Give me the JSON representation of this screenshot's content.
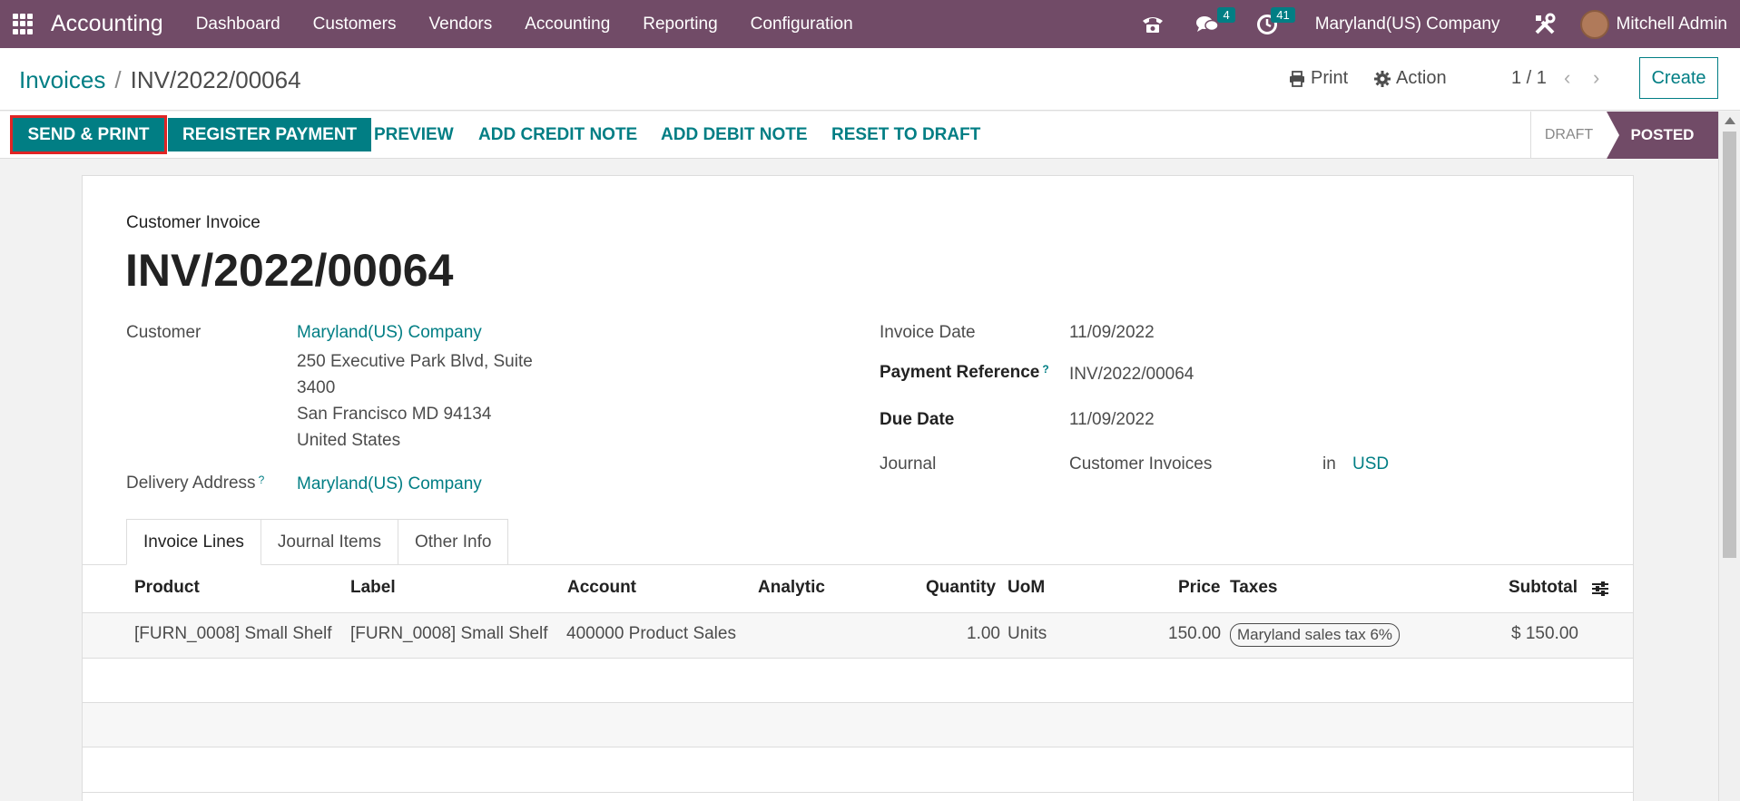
{
  "navbar": {
    "app_name": "Accounting",
    "menu": [
      "Dashboard",
      "Customers",
      "Vendors",
      "Accounting",
      "Reporting",
      "Configuration"
    ],
    "messages_count": "4",
    "activities_count": "41",
    "company": "Maryland(US) Company",
    "user": "Mitchell Admin"
  },
  "control_panel": {
    "breadcrumb_parent": "Invoices",
    "breadcrumb_separator": "/",
    "breadcrumb_current": "INV/2022/00064",
    "print_label": "Print",
    "action_label": "Action",
    "pager": "1 / 1",
    "create_label": "Create"
  },
  "statusbar": {
    "buttons": [
      "SEND & PRINT",
      "REGISTER PAYMENT",
      "PREVIEW",
      "ADD CREDIT NOTE",
      "ADD DEBIT NOTE",
      "RESET TO DRAFT"
    ],
    "stages": [
      "DRAFT",
      "POSTED"
    ],
    "current_stage": "POSTED"
  },
  "invoice": {
    "type_label": "Customer Invoice",
    "number": "INV/2022/00064",
    "customer_label": "Customer",
    "customer_name": "Maryland(US) Company",
    "customer_address": [
      "250 Executive Park Blvd, Suite",
      "3400",
      "San Francisco MD 94134",
      "United States"
    ],
    "delivery_label": "Delivery Address",
    "delivery_value": "Maryland(US) Company",
    "help_mark": "?",
    "invoice_date_label": "Invoice Date",
    "invoice_date": "11/09/2022",
    "payment_ref_label": "Payment Reference",
    "payment_ref": "INV/2022/00064",
    "due_date_label": "Due Date",
    "due_date": "11/09/2022",
    "journal_label": "Journal",
    "journal": "Customer Invoices",
    "journal_in": "in",
    "currency": "USD"
  },
  "tabs": [
    "Invoice Lines",
    "Journal Items",
    "Other Info"
  ],
  "lines": {
    "headers": [
      "Product",
      "Label",
      "Account",
      "Analytic",
      "Quantity",
      "UoM",
      "Price",
      "Taxes",
      "Subtotal"
    ],
    "rows": [
      {
        "product": "[FURN_0008] Small Shelf",
        "label": "[FURN_0008] Small Shelf",
        "account": "400000 Product Sales",
        "analytic": "",
        "quantity": "1.00",
        "uom": "Units",
        "price": "150.00",
        "tax": "Maryland sales tax 6%",
        "subtotal": "$ 150.00"
      }
    ]
  },
  "colors": {
    "navbar": "#714b67",
    "primary": "#017e84",
    "highlight": "#e02424"
  }
}
